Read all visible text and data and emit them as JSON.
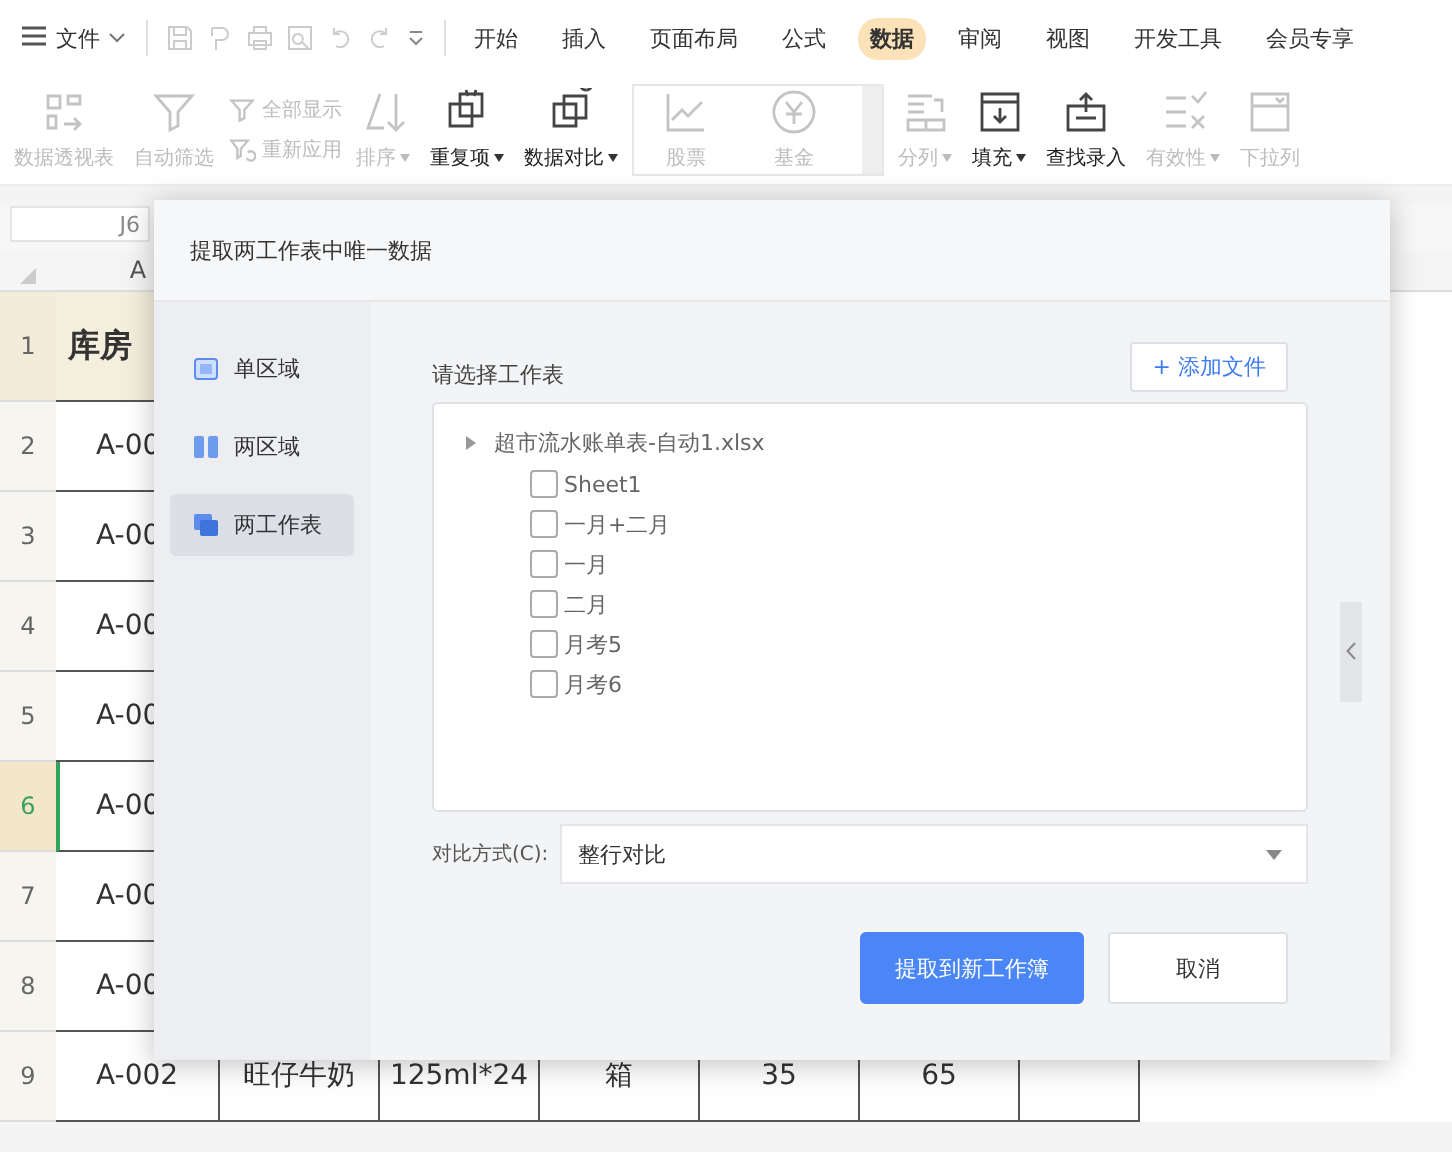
{
  "menu": {
    "label": "文件"
  },
  "tabs": [
    {
      "label": "开始",
      "selected": false
    },
    {
      "label": "插入",
      "selected": false
    },
    {
      "label": "页面布局",
      "selected": false
    },
    {
      "label": "公式",
      "selected": false
    },
    {
      "label": "数据",
      "selected": true
    },
    {
      "label": "审阅",
      "selected": false
    },
    {
      "label": "视图",
      "selected": false
    },
    {
      "label": "开发工具",
      "selected": false
    },
    {
      "label": "会员专享",
      "selected": false
    }
  ],
  "ribbon": [
    {
      "kind": "large",
      "label": "数据透视表",
      "disabled": true,
      "dropdown": false
    },
    {
      "kind": "large",
      "label": "自动筛选",
      "disabled": true,
      "dropdown": false
    },
    {
      "kind": "pair",
      "items": [
        {
          "label": "全部显示",
          "disabled": true
        },
        {
          "label": "重新应用",
          "disabled": true
        }
      ]
    },
    {
      "kind": "large",
      "label": "排序",
      "disabled": true,
      "dropdown": true
    },
    {
      "kind": "large",
      "label": "重复项",
      "disabled": false,
      "dropdown": true
    },
    {
      "kind": "large",
      "label": "数据对比",
      "disabled": false,
      "dropdown": true
    },
    {
      "kind": "gallery",
      "items": [
        {
          "label": "股票",
          "disabled": true
        },
        {
          "label": "基金",
          "disabled": true
        }
      ]
    },
    {
      "kind": "large",
      "label": "分列",
      "disabled": true,
      "dropdown": true
    },
    {
      "kind": "large",
      "label": "填充",
      "disabled": false,
      "dropdown": true
    },
    {
      "kind": "large",
      "label": "查找录入",
      "disabled": false,
      "dropdown": false
    },
    {
      "kind": "large",
      "label": "有效性",
      "disabled": true,
      "dropdown": true
    },
    {
      "kind": "large",
      "label": "下拉列",
      "disabled": true,
      "dropdown": false
    }
  ],
  "sheet": {
    "name_box": "J6",
    "column": "A",
    "rows": [
      {
        "number": "1",
        "selected": false,
        "header": true,
        "cells": [
          "库房"
        ]
      },
      {
        "number": "2",
        "selected": false,
        "header": false,
        "cells": [
          "A-00"
        ]
      },
      {
        "number": "3",
        "selected": false,
        "header": false,
        "cells": [
          "A-00"
        ]
      },
      {
        "number": "4",
        "selected": false,
        "header": false,
        "cells": [
          "A-00"
        ]
      },
      {
        "number": "5",
        "selected": false,
        "header": false,
        "cells": [
          "A-00"
        ]
      },
      {
        "number": "6",
        "selected": true,
        "header": false,
        "cells": [
          "A-00"
        ]
      },
      {
        "number": "7",
        "selected": false,
        "header": false,
        "cells": [
          "A-00"
        ]
      },
      {
        "number": "8",
        "selected": false,
        "header": false,
        "cells": [
          "A-00"
        ]
      },
      {
        "number": "9",
        "selected": false,
        "header": false,
        "cells": [
          "A-002",
          "旺仔牛奶",
          "125ml*24",
          "箱",
          "35",
          "65",
          ""
        ]
      }
    ]
  },
  "dialog": {
    "title": "提取两工作表中唯一数据",
    "nav": [
      {
        "label": "单区域",
        "selected": false
      },
      {
        "label": "两区域",
        "selected": false
      },
      {
        "label": "两工作表",
        "selected": true
      }
    ],
    "sheet_label": "请选择工作表",
    "add_button": "+ 添加文件",
    "file": {
      "name": "超市流水账单表-自动1.xlsx",
      "sheets": [
        {
          "label": "Sheet1",
          "checked": false
        },
        {
          "label": "一月+二月",
          "checked": false
        },
        {
          "label": "一月",
          "checked": false
        },
        {
          "label": "二月",
          "checked": false
        },
        {
          "label": "月考5",
          "checked": false
        },
        {
          "label": "月考6",
          "checked": false
        }
      ]
    },
    "compare_label": "对比方式(C):",
    "compare_value": "整行对比",
    "buttons": [
      {
        "kind": "primary",
        "label": "提取到新工作簿"
      },
      {
        "kind": "secondary",
        "label": "取消"
      }
    ]
  }
}
